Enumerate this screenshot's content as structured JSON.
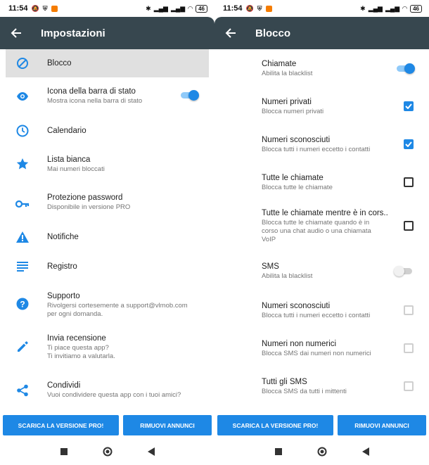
{
  "status": {
    "time": "11:54",
    "battery": "46"
  },
  "left": {
    "title": "Impostazioni",
    "items": [
      {
        "title": "Blocco",
        "subtitle": "",
        "icon": "block-icon"
      },
      {
        "title": "Icona della barra di stato",
        "subtitle": "Mostra icona nella barra di stato",
        "icon": "eye-icon",
        "toggle": true
      },
      {
        "title": "Calendario",
        "subtitle": "",
        "icon": "clock-icon"
      },
      {
        "title": "Lista bianca",
        "subtitle": "Mai numeri bloccati",
        "icon": "star-icon"
      },
      {
        "title": "Protezione password",
        "subtitle": "Disponibile in versione PRO",
        "icon": "key-icon"
      },
      {
        "title": "Notifiche",
        "subtitle": "",
        "icon": "warning-icon"
      },
      {
        "title": "Registro",
        "subtitle": "",
        "icon": "list-icon"
      },
      {
        "title": "Supporto",
        "subtitle": "Rivolgersi cortesemente a support@vlmob.com per ogni domanda.",
        "icon": "help-icon"
      },
      {
        "title": "Invia recensione",
        "subtitle": "Ti piace questa app? Ti invitiamo a valutarla.",
        "icon": "pencil-icon"
      },
      {
        "title": "Condividi",
        "subtitle": "Vuoi condividere questa app con i tuoi amici?",
        "icon": "share-icon"
      }
    ],
    "sub_lines": {
      "support_1": "Rivolgersi cortesemente a support@vlmob.com",
      "support_2": "per ogni domanda.",
      "review_1": "Ti piace questa app?",
      "review_2": "Ti invitiamo a valutarla."
    }
  },
  "right": {
    "title": "Blocco",
    "items": [
      {
        "title": "Chiamate",
        "subtitle": "Abilita la blacklist",
        "control": "toggle-on"
      },
      {
        "title": "Numeri privati",
        "subtitle": "Blocca numeri privati",
        "control": "checked"
      },
      {
        "title": "Numeri sconosciuti",
        "subtitle": "Blocca tutti i numeri eccetto i contatti",
        "control": "checked"
      },
      {
        "title": "Tutte le chiamate",
        "subtitle": "Blocca tutte le chiamate",
        "control": "unchecked"
      },
      {
        "title": "Tutte le chiamate mentre è in cors..",
        "subtitle_1": "Blocca tutte le chiamate quando è in",
        "subtitle_2": "corso una chat audio o una chiamata",
        "subtitle_3": "VoIP",
        "control": "unchecked"
      },
      {
        "title": "SMS",
        "subtitle": "Abilita la blacklist",
        "control": "toggle-off"
      },
      {
        "title": "Numeri sconosciuti",
        "subtitle": "Blocca tutti i numeri eccetto i contatti",
        "control": "disabled"
      },
      {
        "title": "Numeri non numerici",
        "subtitle": "Blocca SMS dai numeri non numerici",
        "control": "disabled"
      },
      {
        "title": "Tutti gli SMS",
        "subtitle": "Blocca SMS da tutti i mittenti",
        "control": "disabled"
      }
    ]
  },
  "buttons": {
    "pro": "SCARICA LA VERSIONE PRO!",
    "ads": "RIMUOVI ANNUNCI"
  },
  "colors": {
    "appbar": "#37474f",
    "accent": "#1e88e5",
    "selected_bg": "#e0e0e0"
  }
}
